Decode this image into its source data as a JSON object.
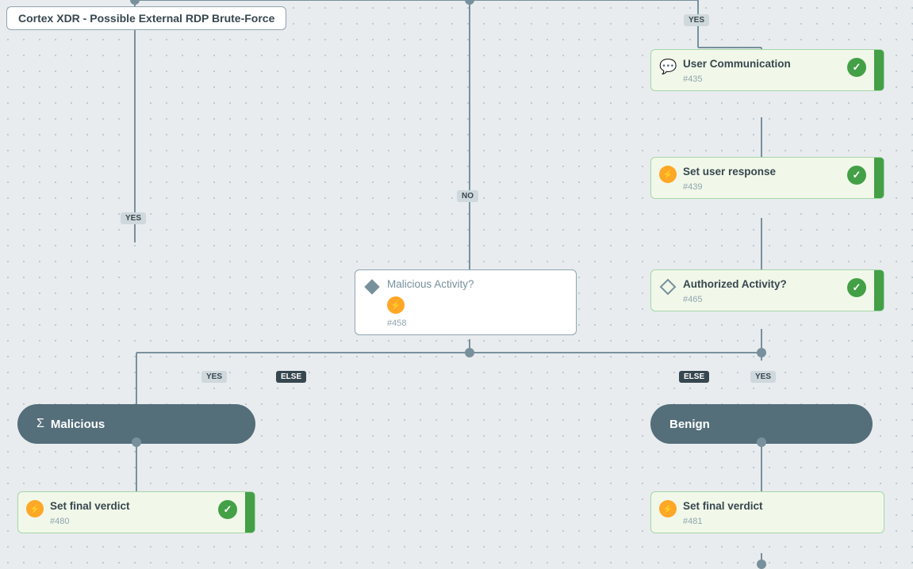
{
  "title": "Cortex XDR - Possible External RDP Brute-Force",
  "nodes": {
    "userCommunication": {
      "title": "User Communication",
      "id": "#435",
      "icon": "chat",
      "hasCheck": true,
      "hasBar": true
    },
    "setUserResponse": {
      "title": "Set user response",
      "id": "#439",
      "icon": "lightning",
      "hasCheck": true,
      "hasBar": true
    },
    "authorizedActivity": {
      "title": "Authorized Activity?",
      "id": "#465",
      "icon": "diamond",
      "hasCheck": true,
      "hasBar": true
    },
    "maliciousActivity": {
      "title": "Malicious Activity?",
      "id": "#458",
      "icon": "diamond"
    },
    "malicious": {
      "title": "Malicious",
      "icon": "sigma"
    },
    "benign": {
      "title": "Benign"
    },
    "setFinalVerdictLeft": {
      "title": "Set final verdict",
      "id": "#480",
      "icon": "lightning",
      "hasCheck": true,
      "hasBar": true
    },
    "setFinalVerdictRight": {
      "title": "Set final verdict",
      "id": "#481",
      "icon": "lightning",
      "hasBar": false
    }
  },
  "labels": {
    "yes1": "YES",
    "yes2": "YES",
    "yes3": "YES",
    "no1": "NO",
    "else1": "ELSE",
    "else2": "ELSE"
  },
  "colors": {
    "cardBg": "#f1f8e9",
    "cardBorder": "#a5d6a7",
    "greenBar": "#43a047",
    "darkTerminal": "#546e7a",
    "connectorLine": "#78909c",
    "labelDark": "#37474f",
    "labelLight": "#cfd8dc"
  }
}
